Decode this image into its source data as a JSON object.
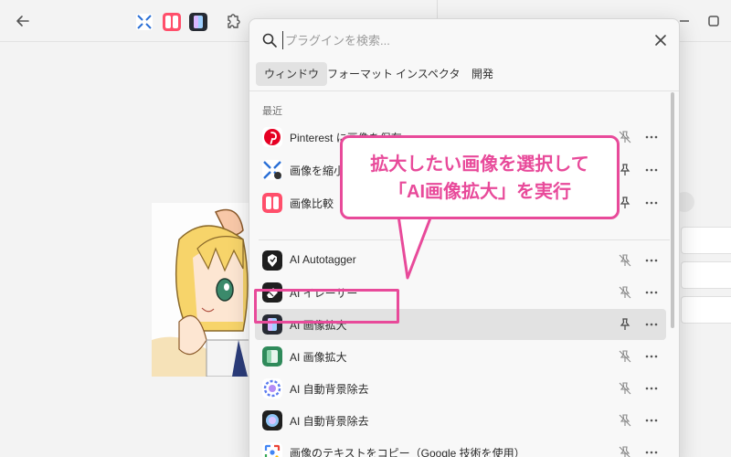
{
  "search": {
    "placeholder": "プラグインを検索..."
  },
  "tabs": [
    {
      "label": "ウィンドウ",
      "active": true
    },
    {
      "label": "フォーマット",
      "active": false
    },
    {
      "label": "インスペクタ",
      "active": false
    },
    {
      "label": "開発",
      "active": false
    }
  ],
  "section": {
    "recent_label": "最近"
  },
  "items": [
    {
      "label": "Pinterest に画像を保存",
      "icon": "pinterest-icon",
      "pinned": false
    },
    {
      "label": "画像を縮小",
      "icon": "shrink-image-icon",
      "pinned": true
    },
    {
      "label": "画像比較",
      "icon": "image-compare-icon",
      "pinned": true
    },
    {
      "label": "AI Autotagger",
      "icon": "ai-autotagger-icon",
      "pinned": false
    },
    {
      "label": "AI イレーサー",
      "icon": "ai-eraser-icon",
      "pinned": false
    },
    {
      "label": "AI 画像拡大",
      "icon": "ai-upscale-icon",
      "pinned": true,
      "selected": true
    },
    {
      "label": "AI 画像拡大",
      "icon": "ai-upscale-alt-icon",
      "pinned": false
    },
    {
      "label": "AI 自動背景除去",
      "icon": "ai-background-remove-icon",
      "pinned": false
    },
    {
      "label": "AI 自動背景除去",
      "icon": "ai-background-remove-alt-icon",
      "pinned": false
    },
    {
      "label": "画像のテキストをコピー（Google 技術を使用）",
      "icon": "google-lens-icon",
      "pinned": false
    }
  ],
  "callout": {
    "line1": "拡大したい画像を選択して",
    "line2": "「AI画像拡大」を実行"
  },
  "colors": {
    "accent": "#e84a9a",
    "selected_row": "#e2e2e2",
    "panel_bg": "#f8f8f8"
  }
}
